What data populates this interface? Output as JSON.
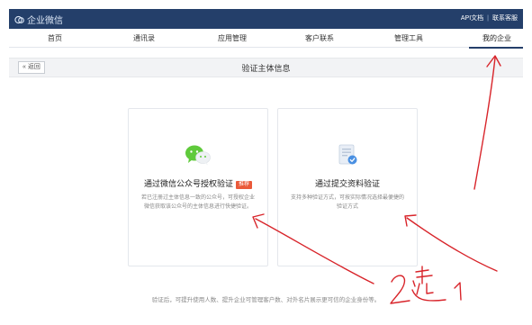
{
  "app": {
    "brand": "企业微信"
  },
  "top_links": {
    "api_docs": "API文档",
    "separator": "|",
    "contact": "联系客服"
  },
  "nav": {
    "items": [
      "首页",
      "通讯录",
      "应用管理",
      "客户联系",
      "管理工具",
      "我的企业"
    ],
    "active": "我的企业"
  },
  "subbar": {
    "back_label": "« 返回",
    "title": "验证主体信息"
  },
  "cards": [
    {
      "title": "通过微信公众号授权验证",
      "badge": "推荐",
      "desc": "若已注册过主体信息一致的公众号，可授权企业微信获取该公众号的主体信息进行快捷验证。",
      "icon": "wechat-icon"
    },
    {
      "title": "通过提交资料验证",
      "desc": "支持多种验证方式，可按实际情况选择最便捷的验证方式",
      "icon": "document-check-icon"
    }
  ],
  "footer": {
    "text": "验证后，可提升使用人数、提升企业可管理客户数、对外名片展示更可信的企业身份等。"
  },
  "annotations": {
    "handwriting": "2选1",
    "color": "#d8242a"
  },
  "colors": {
    "topbar": "#243f6a",
    "badge": "#ea5a3a",
    "wechat_green": "#5fca3b",
    "doc_blue": "#4a90e2"
  }
}
